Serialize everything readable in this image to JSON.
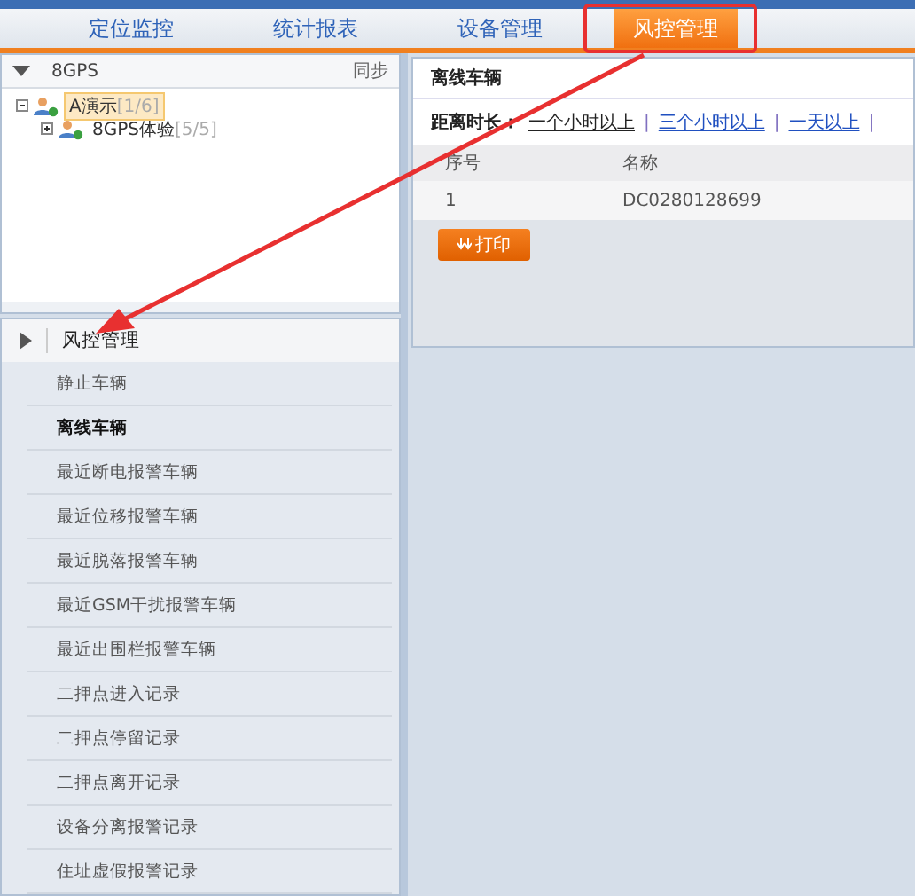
{
  "tabs": [
    {
      "label": "定位监控",
      "selected": false
    },
    {
      "label": "统计报表",
      "selected": false
    },
    {
      "label": "设备管理",
      "selected": false
    },
    {
      "label": "风控管理",
      "selected": true
    }
  ],
  "tree_panel": {
    "title": "8GPS",
    "sync": "同步",
    "nodes": [
      {
        "label": "A演示",
        "count": "[1/6]",
        "expanded": true,
        "selected": true,
        "children": [
          {
            "label": "8GPS体验",
            "count": "[5/5]",
            "expanded": false,
            "selected": false
          }
        ]
      }
    ]
  },
  "menu": {
    "title": "风控管理",
    "items": [
      {
        "label": "静止车辆",
        "selected": false
      },
      {
        "label": "离线车辆",
        "selected": true
      },
      {
        "label": "最近断电报警车辆",
        "selected": false
      },
      {
        "label": "最近位移报警车辆",
        "selected": false
      },
      {
        "label": "最近脱落报警车辆",
        "selected": false
      },
      {
        "label": "最近GSM干扰报警车辆",
        "selected": false
      },
      {
        "label": "最近出围栏报警车辆",
        "selected": false
      },
      {
        "label": "二押点进入记录",
        "selected": false
      },
      {
        "label": "二押点停留记录",
        "selected": false
      },
      {
        "label": "二押点离开记录",
        "selected": false
      },
      {
        "label": "设备分离报警记录",
        "selected": false
      },
      {
        "label": "住址虚假报警记录",
        "selected": false
      }
    ]
  },
  "content": {
    "title": "离线车辆",
    "filter_label": "距离时长：",
    "separator": "|",
    "filters": [
      {
        "label": "一个小时以上",
        "selected": true
      },
      {
        "label": "三个小时以上",
        "selected": false
      },
      {
        "label": "一天以上",
        "selected": false
      }
    ],
    "table": {
      "columns": [
        "序号",
        "名称"
      ],
      "rows": [
        [
          "1",
          "DC0280128699"
        ]
      ]
    },
    "print_button": "打印"
  }
}
